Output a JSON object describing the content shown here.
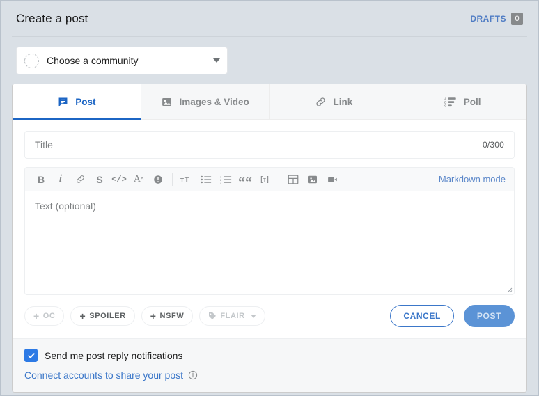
{
  "header": {
    "title": "Create a post",
    "drafts_label": "DRAFTS",
    "drafts_count": "0"
  },
  "community": {
    "placeholder_text": "Choose a community",
    "avatar_icon": "dashed-circle-avatar",
    "caret_icon": "chevron-down-icon"
  },
  "tabs": [
    {
      "label": "Post",
      "icon": "post-icon",
      "active": true
    },
    {
      "label": "Images & Video",
      "icon": "image-icon",
      "active": false
    },
    {
      "label": "Link",
      "icon": "link-icon",
      "active": false
    },
    {
      "label": "Poll",
      "icon": "poll-icon",
      "active": false
    }
  ],
  "title_field": {
    "value": "",
    "placeholder": "Title",
    "counter": "0/300"
  },
  "editor": {
    "textarea_value": "",
    "textarea_placeholder": "Text (optional)",
    "markdown_label": "Markdown mode",
    "toolbar": [
      {
        "name": "bold-icon",
        "label": "B"
      },
      {
        "name": "italic-icon",
        "label": "i"
      },
      {
        "name": "link-icon",
        "label": ""
      },
      {
        "name": "strikethrough-icon",
        "label": "S"
      },
      {
        "name": "code-icon",
        "label": "</>"
      },
      {
        "name": "superscript-icon",
        "label": "A"
      },
      {
        "name": "spoiler-icon",
        "label": "!"
      },
      {
        "name": "heading-icon",
        "label": "T"
      },
      {
        "name": "bulleted-list-icon",
        "label": ""
      },
      {
        "name": "numbered-list-icon",
        "label": ""
      },
      {
        "name": "quote-icon",
        "label": "““"
      },
      {
        "name": "inline-code-icon",
        "label": "T"
      },
      {
        "name": "table-icon",
        "label": ""
      },
      {
        "name": "image-icon",
        "label": ""
      },
      {
        "name": "video-icon",
        "label": ""
      }
    ]
  },
  "tag_buttons": [
    {
      "label": "OC",
      "state": "disabled",
      "icon": "plus-icon"
    },
    {
      "label": "SPOILER",
      "state": "enabled",
      "icon": "plus-icon"
    },
    {
      "label": "NSFW",
      "state": "enabled",
      "icon": "plus-icon"
    },
    {
      "label": "FLAIR",
      "state": "disabled",
      "icon": "tag-icon"
    }
  ],
  "buttons": {
    "cancel_label": "CANCEL",
    "post_label": "POST"
  },
  "footer": {
    "checkbox_label": "Send me post reply notifications",
    "checkbox_checked": true,
    "connect_label": "Connect accounts to share your post",
    "info_icon": "info-icon"
  },
  "colors": {
    "page_bg": "#dae0e6",
    "accent_blue": "#1c65c4",
    "link_blue": "#3b77c9",
    "post_button": "#5b93d6",
    "checkbox_blue": "#2d7ae5",
    "muted_gray": "#878a8c"
  }
}
